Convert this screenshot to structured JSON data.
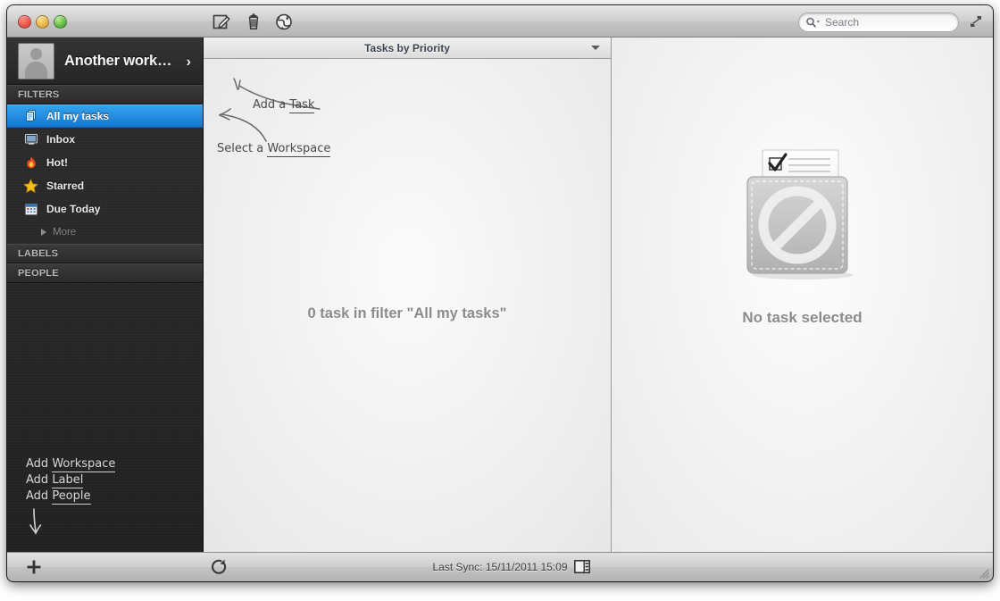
{
  "window": {
    "traffic_lights": [
      "close",
      "minimize",
      "zoom"
    ]
  },
  "toolbar": {
    "compose_icon": "compose-icon",
    "trash_icon": "trash-icon",
    "globe_icon": "globe-icon",
    "search": {
      "placeholder": "Search",
      "value": "",
      "icon": "search-icon"
    },
    "fullscreen_icon": "fullscreen-icon"
  },
  "sidebar": {
    "workspace": {
      "name": "Another work…",
      "chevron": "›",
      "avatar": "avatar-placeholder"
    },
    "sections": [
      {
        "title": "FILTERS"
      },
      {
        "title": "LABELS"
      },
      {
        "title": "PEOPLE"
      }
    ],
    "filters": [
      {
        "label": "All my tasks",
        "icon": "stacked-pages-icon",
        "selected": true
      },
      {
        "label": "Inbox",
        "icon": "inbox-screen-icon",
        "selected": false
      },
      {
        "label": "Hot!",
        "icon": "flame-icon",
        "selected": false
      },
      {
        "label": "Starred",
        "icon": "star-icon",
        "selected": false
      },
      {
        "label": "Due Today",
        "icon": "calendar-icon",
        "selected": false
      }
    ],
    "more_label": "More",
    "notes": [
      {
        "prefix": "Add",
        "link": "Workspace"
      },
      {
        "prefix": "Add",
        "link": "Label"
      },
      {
        "prefix": "Add",
        "link": "People"
      }
    ]
  },
  "list_pane": {
    "header_title": "Tasks by Priority",
    "empty_text": "0 task in filter \"All my tasks\"",
    "notes": [
      {
        "prefix": "Add a",
        "link": "Task"
      },
      {
        "prefix": "Select a",
        "link": "Workspace"
      }
    ]
  },
  "detail_pane": {
    "empty_label": "No task selected",
    "graphic": "no-task-selected-icon"
  },
  "bottombar": {
    "add_icon": "plus-icon",
    "sync_icon": "refresh-icon",
    "sync_status": "Last Sync: 15/11/2011 15:09",
    "layout_toggle_icon": "panel-toggle-icon",
    "resize_grip_icon": "resize-grip-icon"
  },
  "colors": {
    "selection_blue": "#1477d2",
    "sidebar_dark": "#252525",
    "empty_text_gray": "#8b8b8b"
  }
}
